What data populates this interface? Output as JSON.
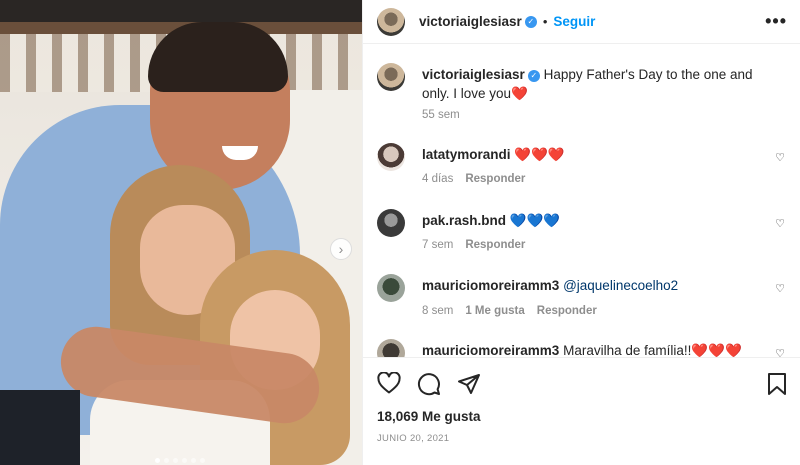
{
  "post": {
    "author": "victoriaiglesiasr",
    "follow_label": "Seguir",
    "separator": "•",
    "more_label": "•••",
    "next_label": "›",
    "slides_total": 6,
    "slide_active": 1
  },
  "caption": {
    "username": "victoriaiglesiasr",
    "text": "Happy Father's Day to the one and only. I love you",
    "emoji": "❤️",
    "time": "55 sem"
  },
  "comments": [
    {
      "username": "latatymorandi",
      "text": "❤️❤️❤️",
      "time": "4 días",
      "likes": "",
      "reply": "Responder"
    },
    {
      "username": "pak.rash.bnd",
      "text": "💙💙💙",
      "time": "7 sem",
      "likes": "",
      "reply": "Responder"
    },
    {
      "username": "mauriciomoreiramm3",
      "mention": "@jaquelinecoelho2",
      "text": "",
      "time": "8 sem",
      "likes": "1 Me gusta",
      "reply": "Responder"
    },
    {
      "username": "mauriciomoreiramm3",
      "text": "Maravilha de família!!❤️❤️❤️",
      "time": "",
      "likes": "",
      "reply": ""
    }
  ],
  "actions": {
    "likes": "18,069 Me gusta",
    "date": "JUNIO 20, 2021"
  },
  "colors": {
    "accent": "#0095f6",
    "verified": "#3897f0",
    "muted": "#8e8e8e"
  }
}
